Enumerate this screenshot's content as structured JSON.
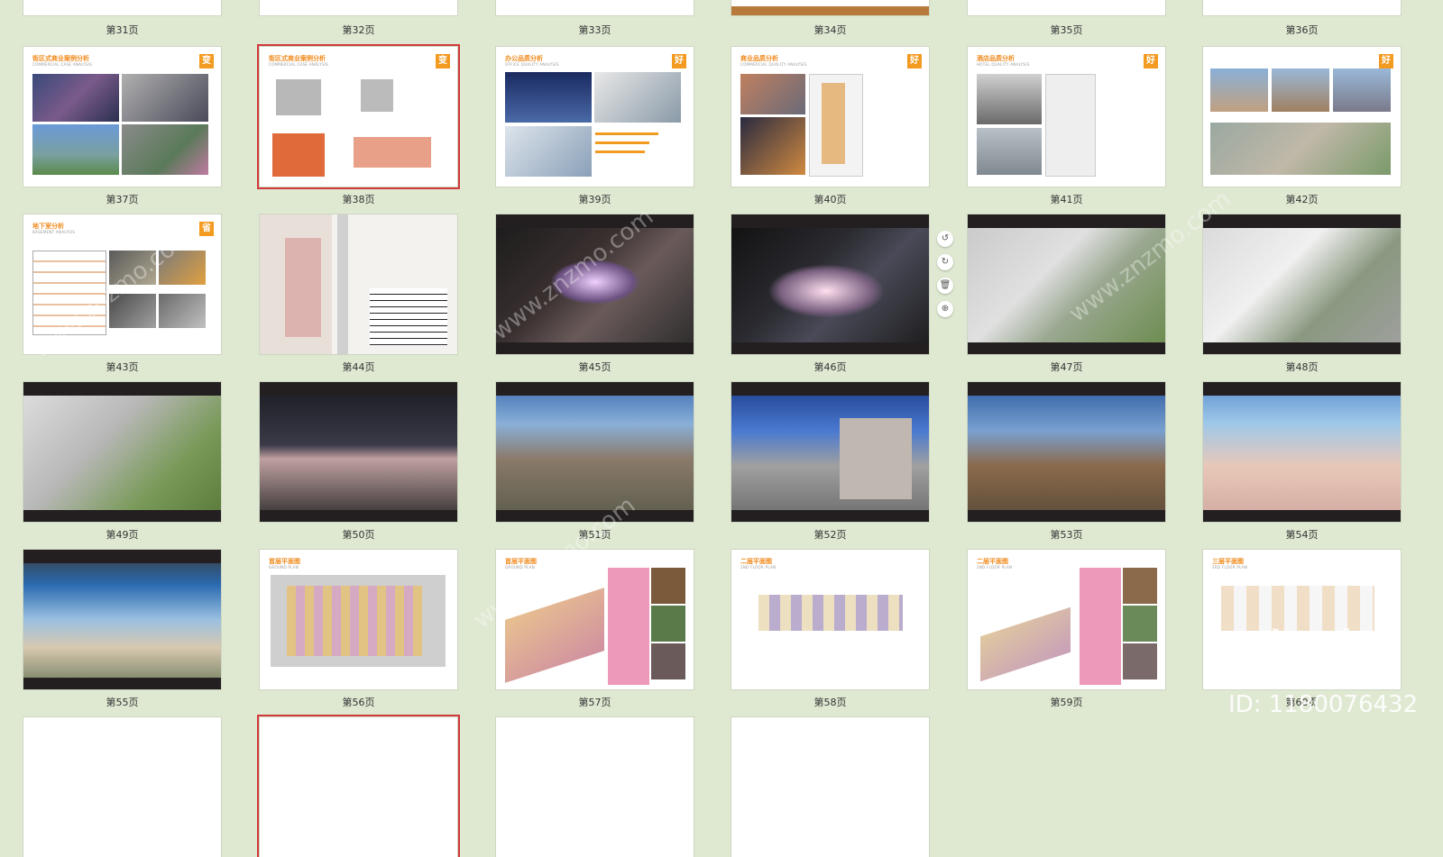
{
  "pages": {
    "p31": "第31页",
    "p32": "第32页",
    "p33": "第33页",
    "p34": "第34页",
    "p35": "第35页",
    "p36": "第36页",
    "p37": "第37页",
    "p38": "第38页",
    "p39": "第39页",
    "p40": "第40页",
    "p41": "第41页",
    "p42": "第42页",
    "p43": "第43页",
    "p44": "第44页",
    "p45": "第45页",
    "p46": "第46页",
    "p47": "第47页",
    "p48": "第48页",
    "p49": "第49页",
    "p50": "第50页",
    "p51": "第51页",
    "p52": "第52页",
    "p53": "第53页",
    "p54": "第54页",
    "p55": "第55页",
    "p56": "第56页",
    "p57": "第57页",
    "p58": "第58页",
    "p59": "第59页",
    "p60": "第60页"
  },
  "slides": {
    "p37": {
      "title": "街区式商业案例分析",
      "sub": "COMMERCIAL CASE ANALYSIS",
      "badge": "变"
    },
    "p38": {
      "title": "街区式商业案例分析",
      "sub": "COMMERCIAL CASE ANALYSIS",
      "badge": "变"
    },
    "p39": {
      "title": "办公品质分析",
      "sub": "OFFICE QUALITY ANALYSIS",
      "badge": "好"
    },
    "p40": {
      "title": "商业品质分析",
      "sub": "COMMERCIAL QUALITY ANALYSIS",
      "badge": "好"
    },
    "p41": {
      "title": "酒店品质分析",
      "sub": "HOTEL QUALITY ANALYSIS",
      "badge": "好"
    },
    "p42": {
      "title": "",
      "sub": "",
      "badge": "好"
    },
    "p43": {
      "title": "地下室分析",
      "sub": "BASEMENT ANALYSIS",
      "badge": "省"
    },
    "p56": {
      "title": "首层平面图",
      "sub": "GROUND PLAN"
    },
    "p57": {
      "title": "首层平面图",
      "sub": "GROUND PLAN"
    },
    "p58": {
      "title": "二层平面图",
      "sub": "2ND FLOOR PLAN"
    },
    "p59": {
      "title": "二层平面图",
      "sub": "2ND FLOOR PLAN"
    },
    "p60": {
      "title": "三层平面图",
      "sub": "3RD FLOOR PLAN"
    }
  },
  "toolbar": {
    "rotate_left": "↺",
    "rotate_right": "↻",
    "delete": "🗑",
    "add": "⊕"
  },
  "watermark": {
    "logo": "知末",
    "id": "ID: 1180076432",
    "diagonal": "www.znzmo.com"
  },
  "colors": {
    "background": "#dfe9d2",
    "accent": "#f39a20",
    "selected_border": "#d23a3a",
    "dark_slide": "#231f20"
  }
}
